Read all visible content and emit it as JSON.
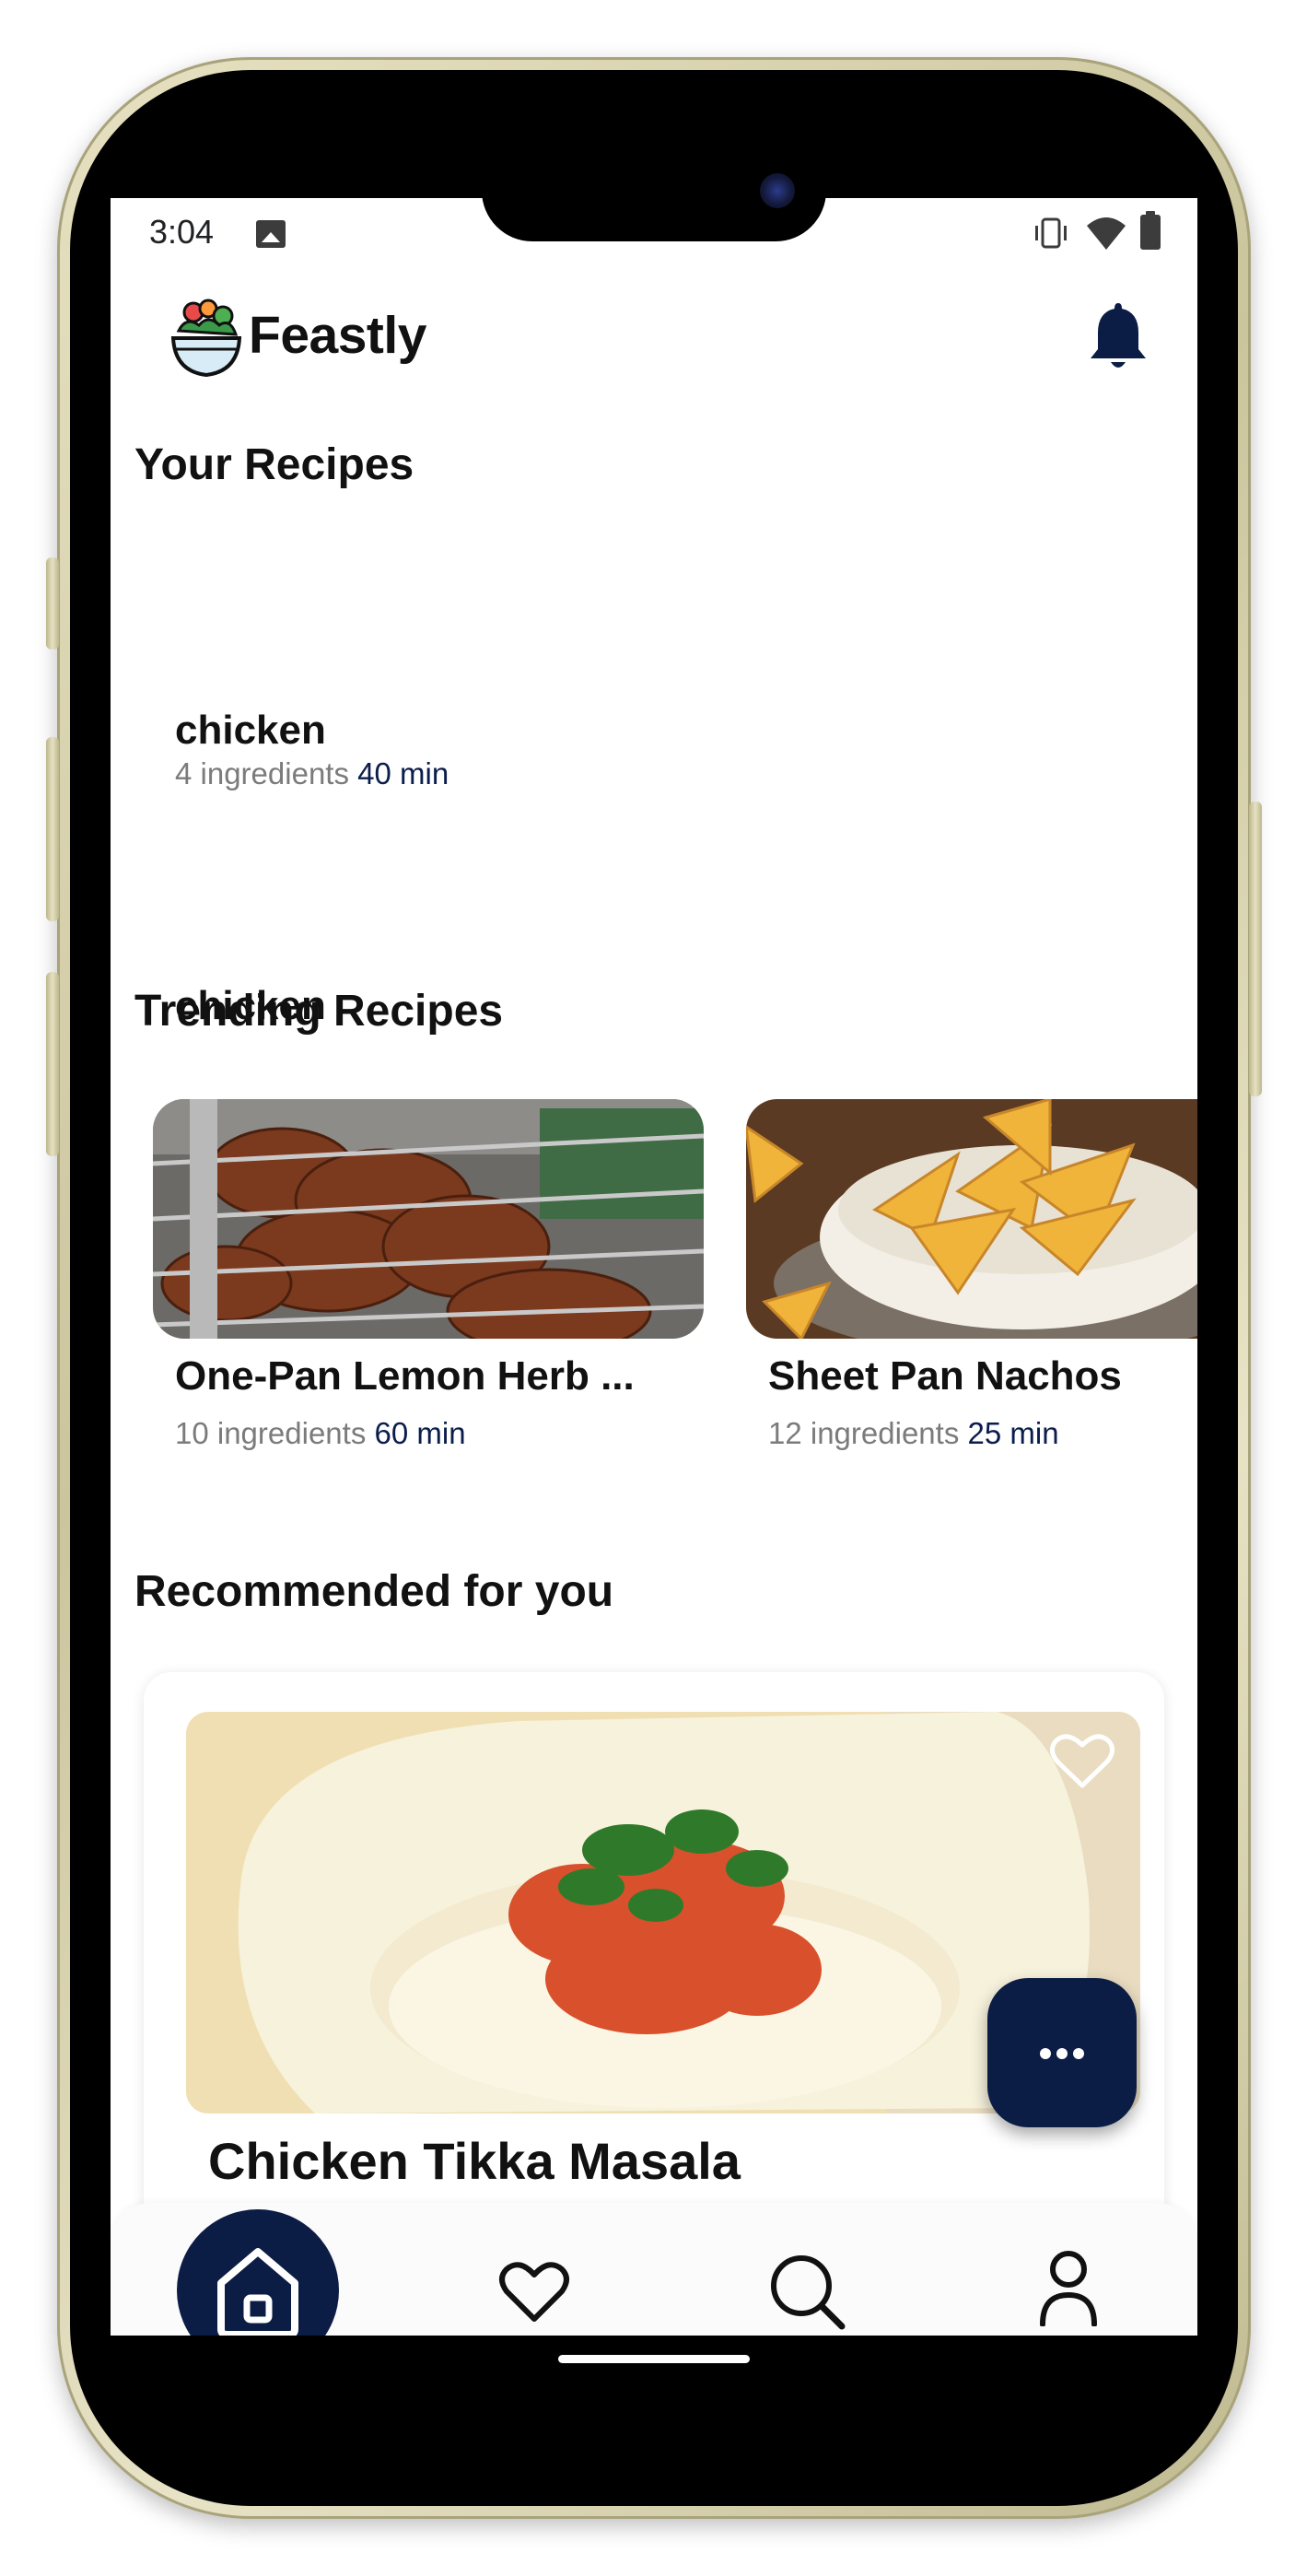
{
  "status_bar": {
    "time": "3:04"
  },
  "header": {
    "brand": "Feastly"
  },
  "your_recipes": {
    "title": "Your Recipes",
    "items": [
      {
        "name": "chicken",
        "ingredients": "4 ingredients",
        "time": "40 min"
      }
    ]
  },
  "trending": {
    "title": "Trending Recipes",
    "items": [
      {
        "name": "One-Pan Lemon Herb ...",
        "ingredients": "10 ingredients",
        "time": "60 min"
      },
      {
        "name": "Sheet Pan Nachos",
        "ingredients": "12 ingredients",
        "time": "25 min"
      }
    ]
  },
  "recommended": {
    "title": "Recommended for you",
    "items": [
      {
        "name": "Chicken Tikka Masala"
      }
    ]
  },
  "bottom_nav": {
    "active": "home",
    "items": [
      "home",
      "favorites",
      "search",
      "profile"
    ]
  },
  "colors": {
    "accent": "#0c1d45",
    "time_text": "#0b1d4d",
    "muted": "#7b7b7b"
  },
  "icons": [
    "gallery-icon",
    "vibrate-icon",
    "wifi-icon",
    "battery-icon",
    "bell-icon",
    "heart-icon",
    "more-icon",
    "home-icon",
    "search-icon",
    "profile-icon"
  ]
}
